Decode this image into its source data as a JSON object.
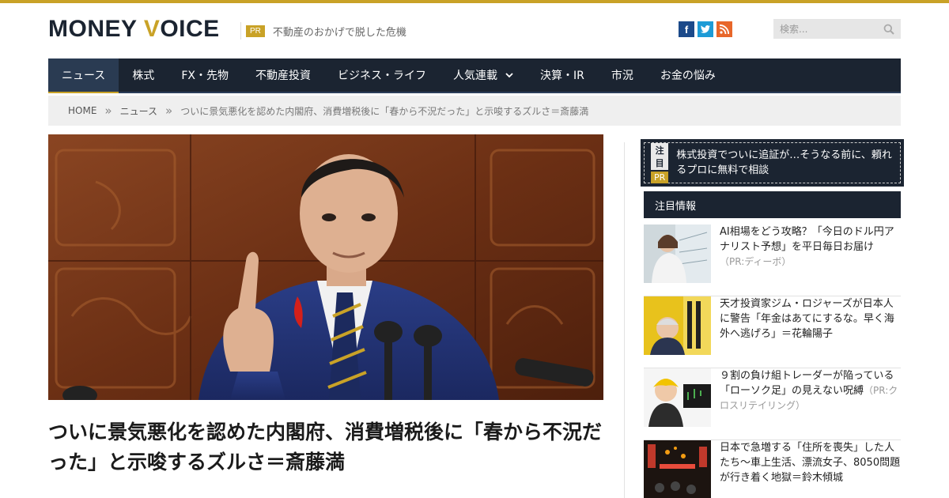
{
  "header": {
    "logo_main": "MONEY ",
    "logo_accent": "V",
    "logo_tail": "OICE",
    "pr_badge": "PR",
    "pr_text": "不動産のおかげで脱した危機",
    "social": {
      "facebook": "f",
      "twitter": "t",
      "rss": "r"
    },
    "search_placeholder": "検索..."
  },
  "nav": {
    "items": [
      {
        "label": "ニュース"
      },
      {
        "label": "株式"
      },
      {
        "label": "FX・先物"
      },
      {
        "label": "不動産投資"
      },
      {
        "label": "ビジネス・ライフ"
      },
      {
        "label": "人気連載"
      },
      {
        "label": "決算・IR"
      },
      {
        "label": "市況"
      },
      {
        "label": "お金の悩み"
      }
    ]
  },
  "breadcrumb": {
    "home": "HOME",
    "sep": "»",
    "section": "ニュース",
    "current": "ついに景気悪化を認めた内閣府、消費増税後に「春から不況だった」と示唆するズルさ＝斎藤満"
  },
  "article": {
    "title": "ついに景気悪化を認めた内閣府、消費増税後に「春から不況だった」と示唆するズルさ＝斎藤満"
  },
  "sidebar": {
    "notice_tag1": "注目",
    "notice_tag2": "PR",
    "notice_text": "株式投資でついに追証が…そうなる前に、頼れるプロに無料で相談",
    "heading": "注目情報",
    "items": [
      {
        "text": "AI相場をどう攻略？「今日のドル円アナリスト予想」を平日毎日お届け",
        "pr": "（PR:ディーボ）"
      },
      {
        "text": "天才投資家ジム・ロジャーズが日本人に警告「年金はあてにするな。早く海外へ逃げろ」＝花輪陽子",
        "pr": ""
      },
      {
        "text": "９割の負け組トレーダーが陥っている「ローソク足」の見えない呪縛",
        "pr": "（PR:クロスリテイリング）"
      },
      {
        "text": "日本で急増する「住所を喪失」した人たち～車上生活、漂流女子、8050問題が行き着く地獄＝鈴木傾城",
        "pr": ""
      }
    ]
  },
  "colors": {
    "navy": "#1b2431",
    "gold": "#c9a227"
  }
}
